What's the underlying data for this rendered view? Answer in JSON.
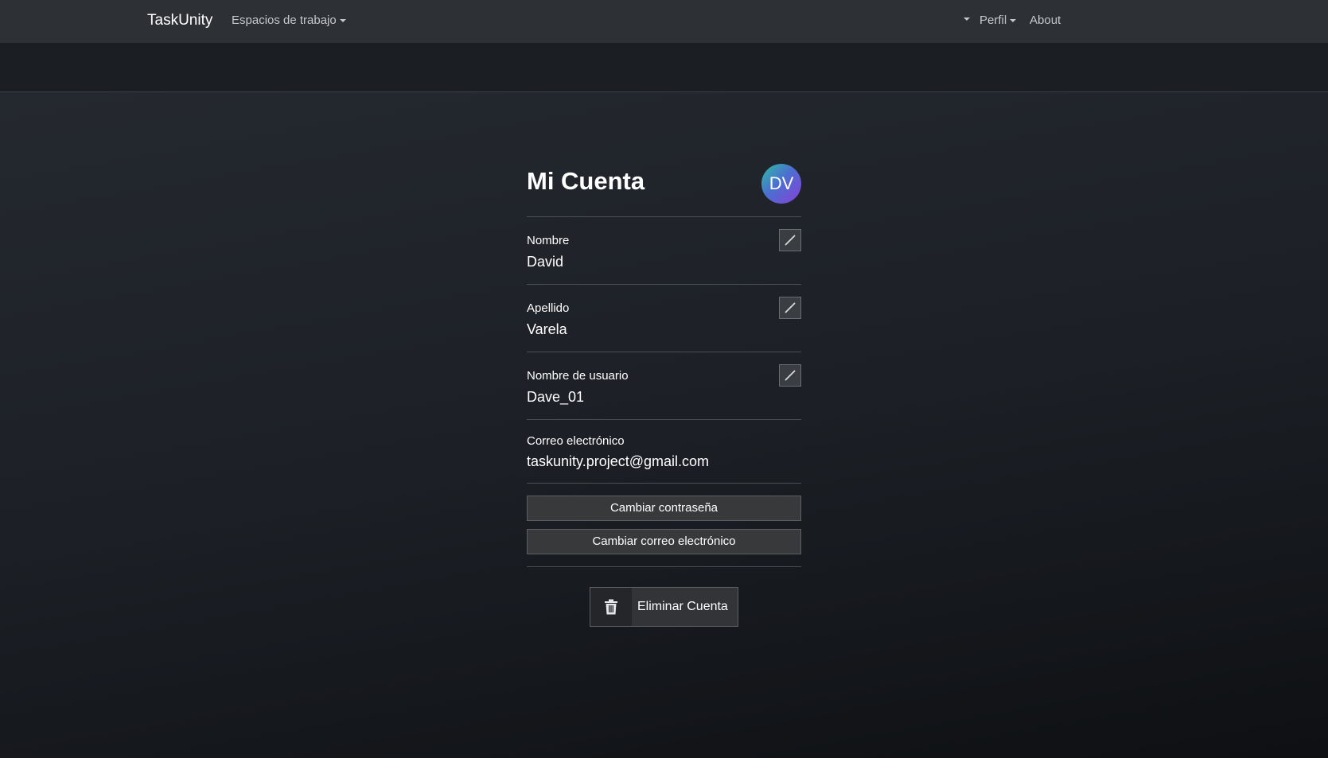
{
  "navbar": {
    "brand": "TaskUnity",
    "workspaces_label": "Espacios de trabajo",
    "profile_label": "Perfil",
    "about_label": "About"
  },
  "account": {
    "title": "Mi Cuenta",
    "avatar_initials": "DV",
    "fields": [
      {
        "label": "Nombre",
        "value": "David"
      },
      {
        "label": "Apellido",
        "value": "Varela"
      },
      {
        "label": "Nombre de usuario",
        "value": "Dave_01"
      },
      {
        "label": "Correo electrónico",
        "value": "taskunity.project@gmail.com"
      }
    ],
    "change_password_label": "Cambiar contraseña",
    "change_email_label": "Cambiar correo electrónico",
    "delete_account_label": "Eliminar Cuenta"
  },
  "icons": {
    "edit": "pencil-icon",
    "delete": "trash-icon",
    "dropdown": "caret-down-icon"
  },
  "colors": {
    "navbar_bg": "#2d3035",
    "page_bg": "#1c2026",
    "avatar_gradient_start": "#2dbfa0",
    "avatar_gradient_end": "#8a3fd8"
  }
}
